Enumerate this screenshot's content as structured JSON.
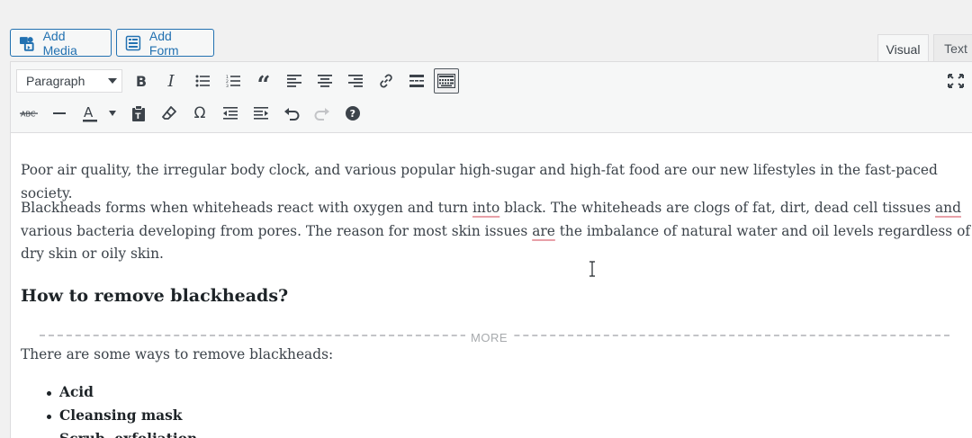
{
  "buttons": {
    "add_media": "Add Media",
    "add_form": "Add Form"
  },
  "tabs": {
    "visual": "Visual",
    "text": "Text"
  },
  "toolbar": {
    "format_select_value": "Paragraph",
    "row1_icons": [
      "bold-icon",
      "italic-icon",
      "bullet-list-icon",
      "numbered-list-icon",
      "blockquote-icon",
      "align-left-icon",
      "align-center-icon",
      "align-right-icon",
      "link-icon",
      "read-more-icon",
      "toolbar-toggle-icon"
    ],
    "row2_icons": [
      "strikethrough-icon",
      "horizontal-line-icon",
      "text-color-icon",
      "paste-as-text-icon",
      "clear-formatting-icon",
      "special-character-icon",
      "outdent-icon",
      "indent-icon",
      "undo-icon",
      "redo-icon",
      "help-icon"
    ],
    "fullscreen_icon": "fullscreen-icon"
  },
  "content": {
    "para1": "Poor air quality, the irregular body clock, and various popular high-sugar and high-fat food are our new lifestyles in the fast-paced society.",
    "para2_a": "Blackheads forms when whiteheads react with oxygen and turn ",
    "para2_into": "into",
    "para2_b": " black. The whiteheads are clogs of fat, dirt, dead cell tissues ",
    "para2_and": "and",
    "para2_c": " various bacteria developing from pores. The reason for most skin issues ",
    "para2_are": "are",
    "para2_d": " the imbalance of natural water and oil levels regardless of dry skin or oily skin.",
    "heading": "How to remove blackheads?",
    "more_label": "MORE",
    "para3": "There are some ways to remove blackheads:",
    "list": [
      "Acid",
      "Cleansing mask",
      "Scrub, exfoliation"
    ]
  },
  "colors": {
    "accent": "#2271b1",
    "spellcheck": "#e8a0a8"
  }
}
